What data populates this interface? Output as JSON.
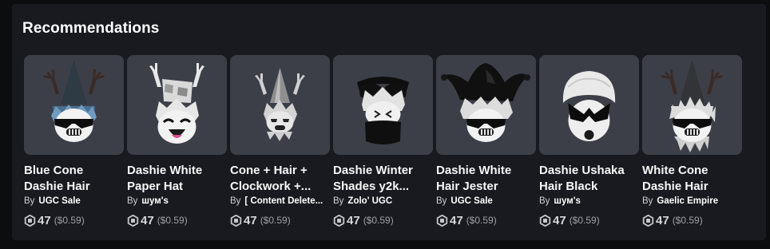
{
  "section": {
    "title": "Recommendations"
  },
  "colors": {
    "panel": "#191a1f",
    "card_bg": "#3d3f48",
    "muted": "#9da0a7"
  },
  "items": [
    {
      "name": "Blue Cone Dashie Hair",
      "by": "By",
      "creator": "UGC Sale",
      "price": "47",
      "usd": "($0.59)",
      "thumbnail": "blue-cone-antler-hair"
    },
    {
      "name": "Dashie White Paper Hat",
      "by": "By",
      "creator": "шум's",
      "price": "47",
      "usd": "($0.59)",
      "thumbnail": "paper-hat-antlers"
    },
    {
      "name": "Cone + Hair + Clockwork +...",
      "by": "By",
      "creator": "[ Content Delete...",
      "price": "47",
      "usd": "($0.59)",
      "thumbnail": "silver-cone-antlers"
    },
    {
      "name": "Dashie Winter Shades y2k...",
      "by": "By",
      "creator": "Zolo' UGC",
      "price": "47",
      "usd": "($0.59)",
      "thumbnail": "winter-shades-mask"
    },
    {
      "name": "Dashie White Hair Jester",
      "by": "By",
      "creator": "UGC Sale",
      "price": "47",
      "usd": "($0.59)",
      "thumbnail": "jester-hat"
    },
    {
      "name": "Dashie Ushaka Hair Black",
      "by": "By",
      "creator": "шум's",
      "price": "47",
      "usd": "($0.59)",
      "thumbnail": "ushaka-hair-black"
    },
    {
      "name": "White Cone Dashie Hair",
      "by": "By",
      "creator": "Gaelic Empire",
      "price": "47",
      "usd": "($0.59)",
      "thumbnail": "white-cone-antler-hair"
    }
  ]
}
